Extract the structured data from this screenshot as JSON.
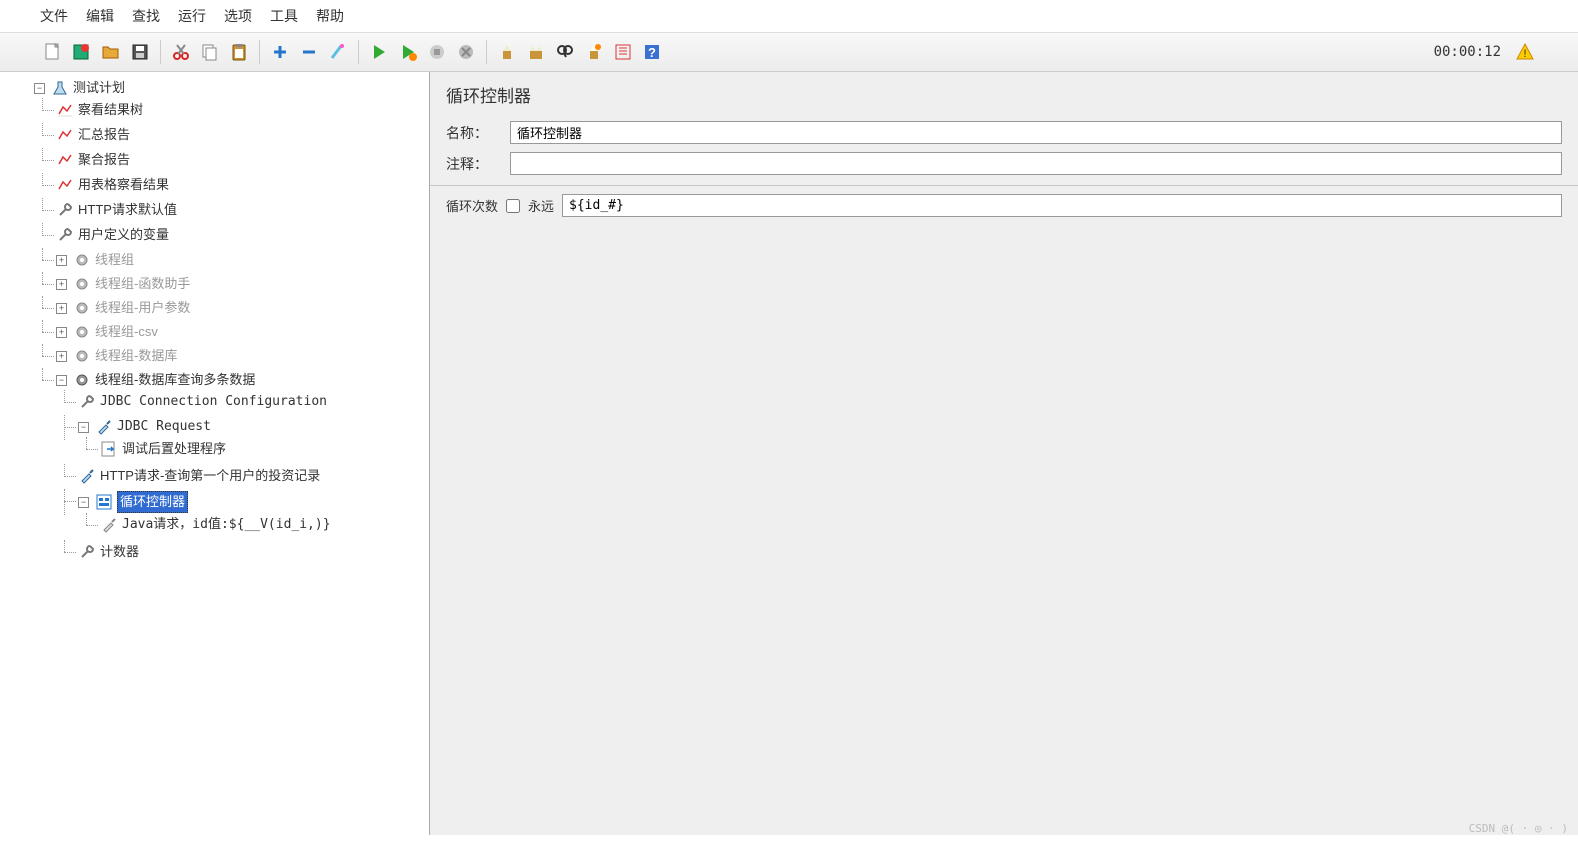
{
  "menu": [
    "文件",
    "编辑",
    "查找",
    "运行",
    "选项",
    "工具",
    "帮助"
  ],
  "timer": "00:00:12",
  "panel": {
    "title": "循环控制器",
    "name_label": "名称：",
    "name_value": "循环控制器",
    "comment_label": "注释：",
    "comment_value": "",
    "loop_label": "循环次数",
    "forever_label": "永远",
    "loop_value": "${id_#}"
  },
  "tree": {
    "root": "测试计划",
    "n1": "察看结果树",
    "n2": "汇总报告",
    "n3": "聚合报告",
    "n4": "用表格察看结果",
    "n5": "HTTP请求默认值",
    "n6": "用户定义的变量",
    "g1": "线程组",
    "g2": "线程组-函数助手",
    "g3": "线程组-用户参数",
    "g4": "线程组-csv",
    "g5": "线程组-数据库",
    "g6": "线程组-数据库查询多条数据",
    "g6a": "JDBC Connection Configuration",
    "g6b": "JDBC Request",
    "g6b1": "调试后置处理程序",
    "g6c": "HTTP请求-查询第一个用户的投资记录",
    "g6d": "循环控制器",
    "g6d1": "Java请求，id值:${__V(id_i,)}",
    "g6e": "计数器"
  },
  "watermark": "CSDN @( · ◎ · )"
}
